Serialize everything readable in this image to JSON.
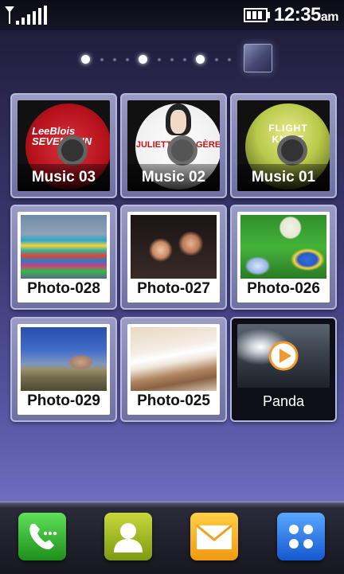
{
  "status_bar": {
    "time": "12:35",
    "ampm": "am",
    "icons": [
      "signal-icon",
      "battery-icon"
    ]
  },
  "home_pages": {
    "page_count": 3,
    "current_page": 1
  },
  "tiles": [
    {
      "label": "Music 03",
      "type": "music",
      "art_text": "LeeBlois SEVENPHIN"
    },
    {
      "label": "Music 02",
      "type": "music",
      "art_text": "JULIETTE IMAGÈRE"
    },
    {
      "label": "Music 01",
      "type": "music",
      "art_text": "FLIGHT KNIFE"
    },
    {
      "label": "Photo-028",
      "type": "photo"
    },
    {
      "label": "Photo-027",
      "type": "photo"
    },
    {
      "label": "Photo-026",
      "type": "photo"
    },
    {
      "label": "Photo-029",
      "type": "photo"
    },
    {
      "label": "Photo-025",
      "type": "photo"
    },
    {
      "label": "Panda",
      "type": "video"
    }
  ],
  "dock": {
    "items": [
      "phone-icon",
      "contacts-icon",
      "messages-icon",
      "menu-icon"
    ]
  },
  "colors": {
    "phone": "#2fb82a",
    "contacts": "#a4bd22",
    "messages": "#f6b42b",
    "menu": "#2a78e8"
  }
}
